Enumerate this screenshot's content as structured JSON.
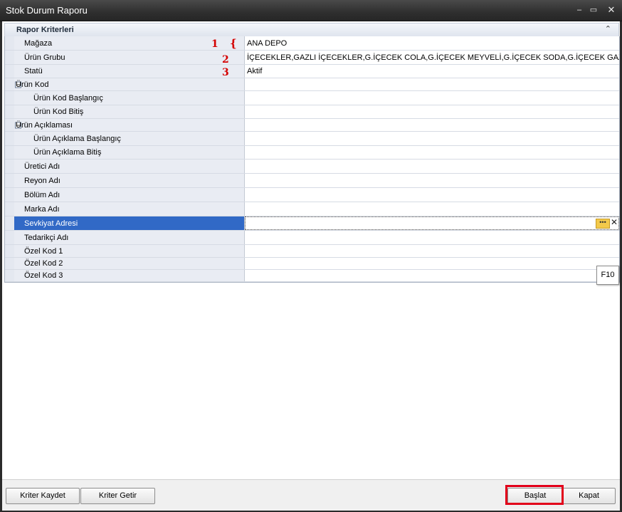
{
  "window": {
    "title": "Stok Durum Raporu",
    "controls": [
      "minimize-icon",
      "maximize-icon",
      "close-icon"
    ]
  },
  "panel": {
    "title": "Rapor Kriterleri"
  },
  "rows": [
    {
      "label": "Mağaza",
      "value": "ANA DEPO",
      "level": 0
    },
    {
      "label": "Ürün Grubu",
      "value": "İÇECEKLER,GAZLI İÇECEKLER,G.İÇECEK COLA,G.İÇECEK MEYVELİ,G.İÇECEK SODA,G.İÇECEK GAZOZ,G....",
      "level": 0
    },
    {
      "label": "Statü",
      "value": "Aktif",
      "level": 0
    },
    {
      "label": "Ürün Kod",
      "value": "",
      "level": 0,
      "expanded": true
    },
    {
      "label": "Ürün Kod Başlangıç",
      "value": "",
      "level": 1
    },
    {
      "label": "Ürün Kod Bitiş",
      "value": "",
      "level": 1
    },
    {
      "label": "Ürün Açıklaması",
      "value": "",
      "level": 0,
      "expanded": true
    },
    {
      "label": "Ürün Açıklama Başlangıç",
      "value": "",
      "level": 1
    },
    {
      "label": "Ürün Açıklama Bitiş",
      "value": "",
      "level": 1
    },
    {
      "label": "Üretici Adı",
      "value": "",
      "level": 0
    },
    {
      "label": "Reyon Adı",
      "value": "",
      "level": 0
    },
    {
      "label": "Bölüm Adı",
      "value": "",
      "level": 0
    },
    {
      "label": "Marka Adı",
      "value": "",
      "level": 0
    },
    {
      "label": "Sevkiyat Adresi",
      "value": "",
      "level": 0,
      "selected": true
    },
    {
      "label": "Tedarikçi Adı",
      "value": "",
      "level": 0
    },
    {
      "label": "Özel Kod 1",
      "value": "",
      "level": 0
    },
    {
      "label": "Özel Kod 2",
      "value": "",
      "level": 0
    },
    {
      "label": "Özel Kod 3",
      "value": "",
      "level": 0
    }
  ],
  "annotations": {
    "a1": "1",
    "brace": "{",
    "a2": "2",
    "a3": "3"
  },
  "editor": {
    "ellipsis": "•••",
    "clear": "✕",
    "tooltip": "F10"
  },
  "footer": {
    "save_criteria": "Kriter Kaydet",
    "load_criteria": "Kriter Getir",
    "start": "Başlat",
    "close": "Kapat"
  },
  "colors": {
    "selection": "#3169c6",
    "highlight_box": "#e2001a",
    "annotation": "#d40000"
  }
}
